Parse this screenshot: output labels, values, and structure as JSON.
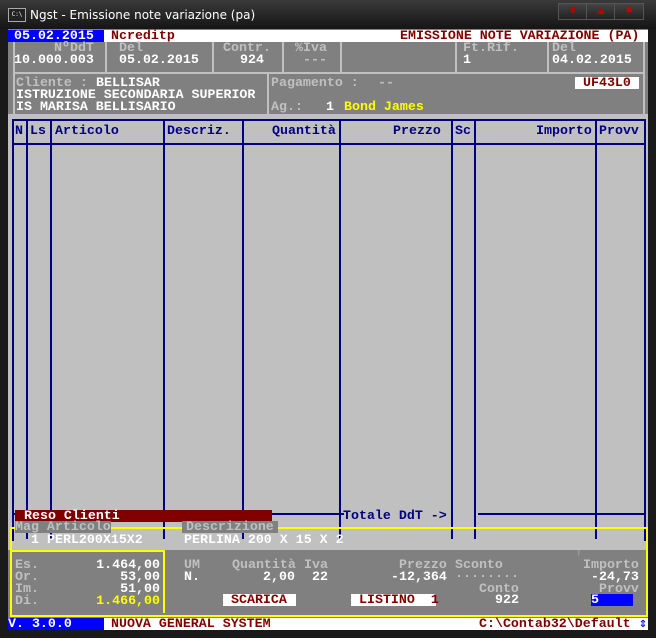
{
  "window": {
    "title": "Ngst - Emissione note variazione (pa)",
    "icon": "console-icon",
    "controls": [
      "minimize",
      "maximize",
      "close"
    ]
  },
  "topbar": {
    "date": "05.02.2015",
    "program": "Ncreditp",
    "heading": "EMISSIONE NOTE VARIAZIONE (PA)"
  },
  "header": {
    "nddt_label": "NºDdT",
    "nddt": "10.000.003",
    "del_label": "Del",
    "del": "05.02.2015",
    "contr_label": "Contr.",
    "contr": "924",
    "iva_label": "%Iva",
    "iva": "---",
    "ftrif_label": "Ft.Rif.",
    "ftrif": "1",
    "del2_label": "Del",
    "del2": "04.02.2015"
  },
  "client": {
    "label": "Cliente :",
    "code": "BELLISAR",
    "line2": "ISTRUZIONE SECONDARIA SUPERIOR",
    "line3": "IS MARISA BELLISARIO",
    "pagamento_label": "Pagamento :",
    "pagamento": "--",
    "code_box": "UF43L0",
    "agent_label": "Ag.:",
    "agent_num": "1",
    "agent_name": "Bond James"
  },
  "table": {
    "columns": [
      "N",
      "Ls",
      "Articolo",
      "Descriz.",
      "Quantità",
      "Prezzo",
      "Sc",
      "Importo",
      "Provv"
    ],
    "rows": []
  },
  "footer_bar": {
    "causale": "Reso Clienti",
    "totale_label": "Totale DdT ->"
  },
  "detail": {
    "mag_label": "Mag Articolo",
    "mag": "1",
    "articolo": "PERL200X15X2",
    "descr_label": "Descrizione",
    "descrizione": "PERLINA 200 X 15 X 2",
    "stock": [
      {
        "label": "Es.",
        "value": "1.464,00"
      },
      {
        "label": "Or.",
        "value": "53,00"
      },
      {
        "label": "Im.",
        "value": "51,00"
      },
      {
        "label": "Di.",
        "value": "1.466,00"
      }
    ],
    "um_label": "UM",
    "um": "N.",
    "qta_label": "Quantità",
    "qta": "2,00",
    "iva_label": "Iva",
    "iva": "22",
    "prezzo_label": "Prezzo",
    "prezzo": "-12,364",
    "sconto_label": "Sconto",
    "sconto": "........",
    "importo_label": "Importo",
    "importo": "-24,73",
    "arrow": "↑",
    "scarica": "SCARICA",
    "listino": "LISTINO  1",
    "conto_label": "Conto",
    "conto": "922",
    "provv_label": "Provv",
    "provv": "5"
  },
  "status": {
    "version": "V. 3.0.0",
    "company": "NUOVA GENERAL SYSTEM",
    "path": "C:\\Contab32\\Default"
  },
  "colors": {
    "navy": "#000080",
    "maroon": "#800000",
    "blue": "#0000ff",
    "yellow": "#ffff00",
    "gray": "#808080",
    "lightgray": "#c0c0c0"
  }
}
